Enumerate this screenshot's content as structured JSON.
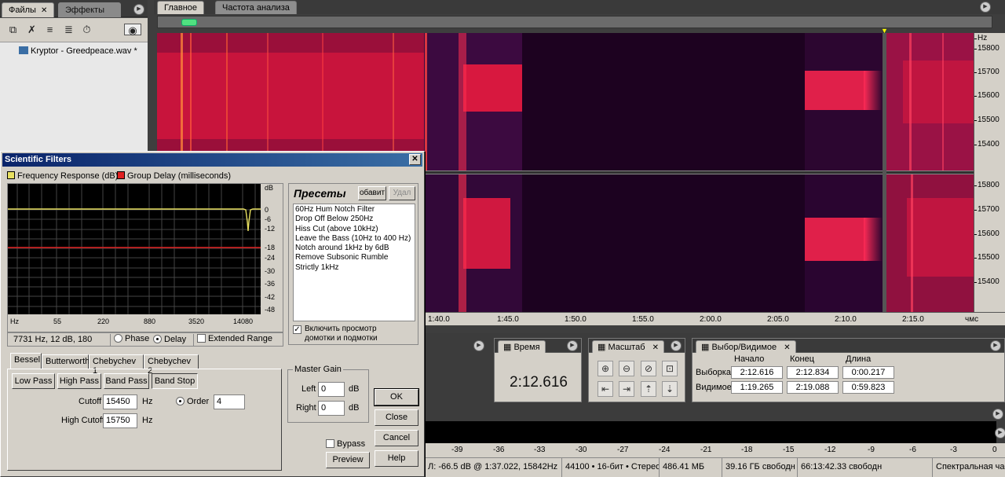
{
  "files_panel": {
    "tabs": [
      {
        "label": "Файлы"
      },
      {
        "label": "Эффекты"
      }
    ],
    "file_item": "Kryptor - Greedpeace.wav *"
  },
  "main_tabs": [
    {
      "label": "Главное"
    },
    {
      "label": "Частота анализа"
    }
  ],
  "hz_scale": {
    "unit": "Hz",
    "ch1": [
      "15800",
      "15700",
      "15600",
      "15500",
      "15400"
    ],
    "ch2": [
      "15800",
      "15700",
      "15600",
      "15500",
      "15400"
    ]
  },
  "time_ruler": {
    "ticks": [
      "1:40.0",
      "1:45.0",
      "1:50.0",
      "1:55.0",
      "2:00.0",
      "2:05.0",
      "2:10.0",
      "2:15.0"
    ],
    "unit": "чмс"
  },
  "time_panel": {
    "label": "Время",
    "value": "2:12.616"
  },
  "zoom_panel": {
    "label": "Масштаб"
  },
  "selection_panel": {
    "label": "Выбор/Видимое",
    "headers": [
      "Начало",
      "Конец",
      "Длина"
    ],
    "rows": [
      {
        "label": "Выборка",
        "start": "2:12.616",
        "end": "2:12.834",
        "length": "0:00.217"
      },
      {
        "label": "Видимое",
        "start": "1:19.265",
        "end": "2:19.088",
        "length": "0:59.823"
      }
    ]
  },
  "meter_scale": [
    "-39",
    "-36",
    "-33",
    "-30",
    "-27",
    "-24",
    "-21",
    "-18",
    "-15",
    "-12",
    "-9",
    "-6",
    "-3",
    "0"
  ],
  "status_bar": [
    "Л: -66.5 dB @  1:37.022, 15842Hz",
    "44100 • 16-бит • Стерео",
    "486.41 МБ",
    "39.16 ГБ свободн",
    "66:13:42.33 свободн",
    "Спектральная час"
  ],
  "dialog": {
    "title": "Scientific Filters",
    "close": "✕",
    "legend": {
      "freq": "Frequency Response (dB)",
      "delay": "Group Delay (milliseconds)"
    },
    "db_axis": {
      "unit": "dB",
      "ticks": [
        "0",
        "-6",
        "-12",
        "-18",
        "-24",
        "-30",
        "-36",
        "-42",
        "-48"
      ]
    },
    "freq_axis": [
      "Hz",
      "55",
      "220",
      "880",
      "3520",
      "14080"
    ],
    "readout": "7731 Hz, 12 dB, 180",
    "phase_label": "Phase",
    "delay_label": "Delay",
    "extended_label": "Extended Range",
    "presets": {
      "title": "Пресеты",
      "add": "обавит",
      "delete": "Удал",
      "items": [
        "60Hz Hum Notch Filter",
        "Drop Off Below 250Hz",
        "Hiss Cut (above 10kHz)",
        "Leave the Bass (10Hz to 400 Hz)",
        "Notch around 1kHz by 6dB",
        "Remove Subsonic Rumble",
        "Strictly 1kHz"
      ],
      "preview_line1": "Включить просмотр",
      "preview_line2": "домотки и подмотки"
    },
    "filter_tabs": [
      "Bessel",
      "Butterworth",
      "Chebychev 1",
      "Chebychev 2"
    ],
    "types": [
      "Low Pass",
      "High Pass",
      "Band Pass",
      "Band Stop"
    ],
    "cutoff_label": "Cutoff",
    "cutoff": "15450",
    "high_cutoff_label": "High Cutoff",
    "high_cutoff": "15750",
    "hz": "Hz",
    "order_label": "Order",
    "order": "4",
    "master_gain": {
      "title": "Master Gain",
      "left_label": "Left",
      "left": "0",
      "right_label": "Right",
      "right": "0",
      "unit": "dB"
    },
    "bypass": "Bypass",
    "buttons": {
      "ok": "OK",
      "close": "Close",
      "cancel": "Cancel",
      "preview": "Preview",
      "help": "Help"
    }
  }
}
